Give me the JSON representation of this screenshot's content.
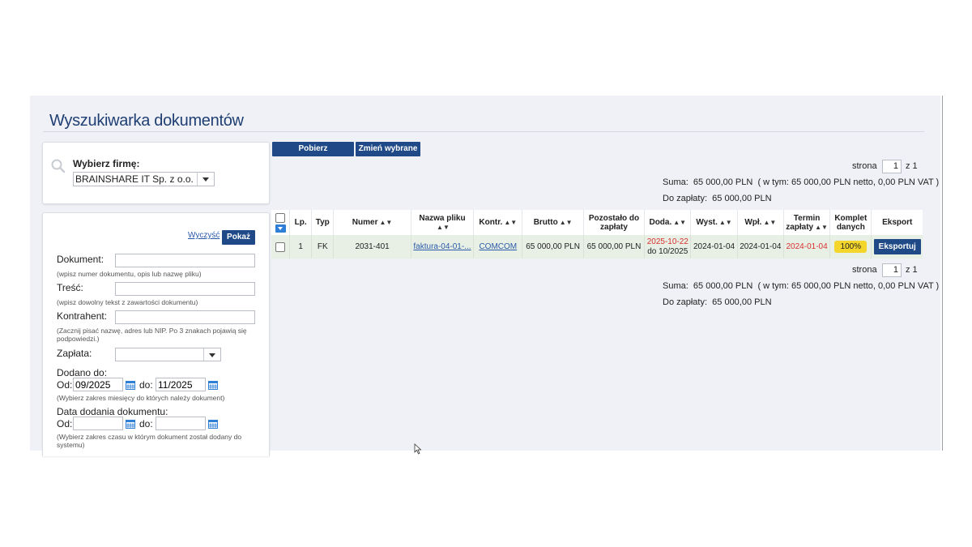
{
  "page_title": "Wyszukiwarka dokumentów",
  "firm": {
    "label": "Wybierz firmę:",
    "selected": "BRAINSHARE IT Sp. z o.o."
  },
  "filters": {
    "clear_label": "Wyczyść",
    "show_label": "Pokaż",
    "document": {
      "label": "Dokument:",
      "value": "",
      "hint": "(wpisz numer dokumentu, opis lub nazwę pliku)"
    },
    "content": {
      "label": "Treść:",
      "value": "",
      "hint": "(wpisz dowolny tekst z zawartości dokumentu)"
    },
    "contractor": {
      "label": "Kontrahent:",
      "value": "",
      "hint_line1": "(Zacznij pisać nazwę, adres lub NIP. Po 3 znakach pojawią się",
      "hint_line2": "podpowiedzi.)"
    },
    "payment": {
      "label": "Zapłata:",
      "selected": ""
    },
    "added_to": {
      "label": "Dodano do:",
      "from_label": "Od:",
      "from_value": "09/2025",
      "to_label": "do:",
      "to_value": "11/2025",
      "hint": "(Wybierz zakres miesięcy do których należy dokument)"
    },
    "added_date": {
      "label": "Data dodania dokumentu:",
      "from_label": "Od:",
      "from_value": "",
      "to_label": "do:",
      "to_value": "",
      "hint_line1": "(Wybierz zakres czasu w którym dokument został dodany do",
      "hint_line2": "systemu)"
    }
  },
  "toolbar": {
    "fetch_label": "Pobierz",
    "change_label": "Zmień wybrane"
  },
  "pagination": {
    "label": "strona",
    "page": "1",
    "of": "z 1"
  },
  "summary": {
    "sum_label": "Suma:",
    "sum_value": "65 000,00 PLN",
    "sum_detail": "( w tym: 65 000,00 PLN netto, 0,00 PLN VAT )",
    "due_label": "Do zapłaty:",
    "due_value": "65 000,00 PLN"
  },
  "table": {
    "headers": {
      "lp": "Lp.",
      "typ": "Typ",
      "numer": "Numer",
      "plik": "Nazwa pliku",
      "kontr": "Kontr.",
      "brutto": "Brutto",
      "pozostalo1": "Pozostało do",
      "pozostalo2": "zapłaty",
      "doda": "Doda.",
      "wyst": "Wyst.",
      "wpl": "Wpł.",
      "termin1": "Termin",
      "termin2": "zapłaty",
      "komplet1": "Komplet",
      "komplet2": "danych",
      "eksport": "Eksport"
    },
    "rows": [
      {
        "lp": "1",
        "typ": "FK",
        "numer": "2031-401",
        "plik": "faktura-04-01-...",
        "kontr": "COMCOM",
        "brutto": "65 000,00 PLN",
        "pozostalo": "65 000,00 PLN",
        "doda_date": "2025-10-22",
        "doda_period": "do 10/2025",
        "wyst": "2024-01-04",
        "wpl": "2024-01-04",
        "termin": "2024-01-04",
        "komplet": "100%",
        "eksport_label": "Eksportuj"
      }
    ]
  },
  "colors": {
    "accent": "#1f4a87",
    "title": "#1f3f73",
    "overdue": "#d93030",
    "complete_badge": "#f3d52c"
  }
}
